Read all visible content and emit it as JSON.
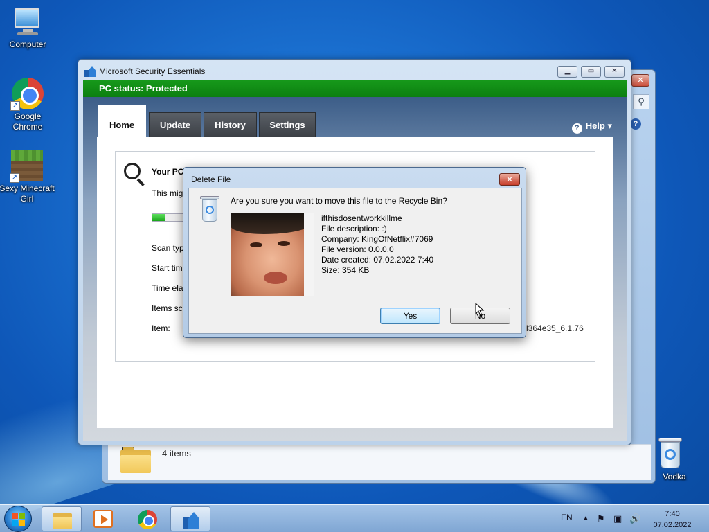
{
  "desktop": {
    "icons": [
      {
        "label": "Computer"
      },
      {
        "label": "Google Chrome"
      },
      {
        "label": "Sexy Minecraft Girl"
      },
      {
        "label": "Vodka"
      }
    ]
  },
  "explorer": {
    "status": "4 items",
    "close_glyph": "✕",
    "search_glyph": "⚲",
    "help_glyph": "?"
  },
  "mse": {
    "title": "Microsoft Security Essentials",
    "status": "PC status: Protected",
    "status_color": "#0c7f10",
    "tabs": [
      "Home",
      "Update",
      "History",
      "Settings"
    ],
    "active_tab": "Home",
    "help_label": "Help ▾",
    "help_glyph": "?",
    "caption": {
      "minimize": "▁",
      "maximize": "▭",
      "close": "✕"
    },
    "scan": {
      "heading": "Your PC",
      "subtext": "This mig",
      "progress": 0.1,
      "labels": [
        "Scan typ",
        "Start tim",
        "Time ela",
        "Items sca",
        "Item:"
      ],
      "item_path": "l364e35_6.1.76"
    }
  },
  "dialog": {
    "title": "Delete File",
    "close_glyph": "✕",
    "question": "Are you sure you want to move this file to the Recycle Bin?",
    "file": {
      "name": "ifthisdosentworkkillme",
      "description": "File description: :)",
      "company": "Company: KingOfNetflix#7069",
      "version": "File version: 0.0.0.0",
      "created": "Date created: 07.02.2022 7:40",
      "size": "Size: 354 KB"
    },
    "buttons": {
      "yes": "Yes",
      "no": "No"
    }
  },
  "taskbar": {
    "language": "EN",
    "tray_icons": [
      "▲",
      "⚑",
      "▣",
      "🔊"
    ],
    "time": "7:40",
    "date": "07.02.2022"
  }
}
